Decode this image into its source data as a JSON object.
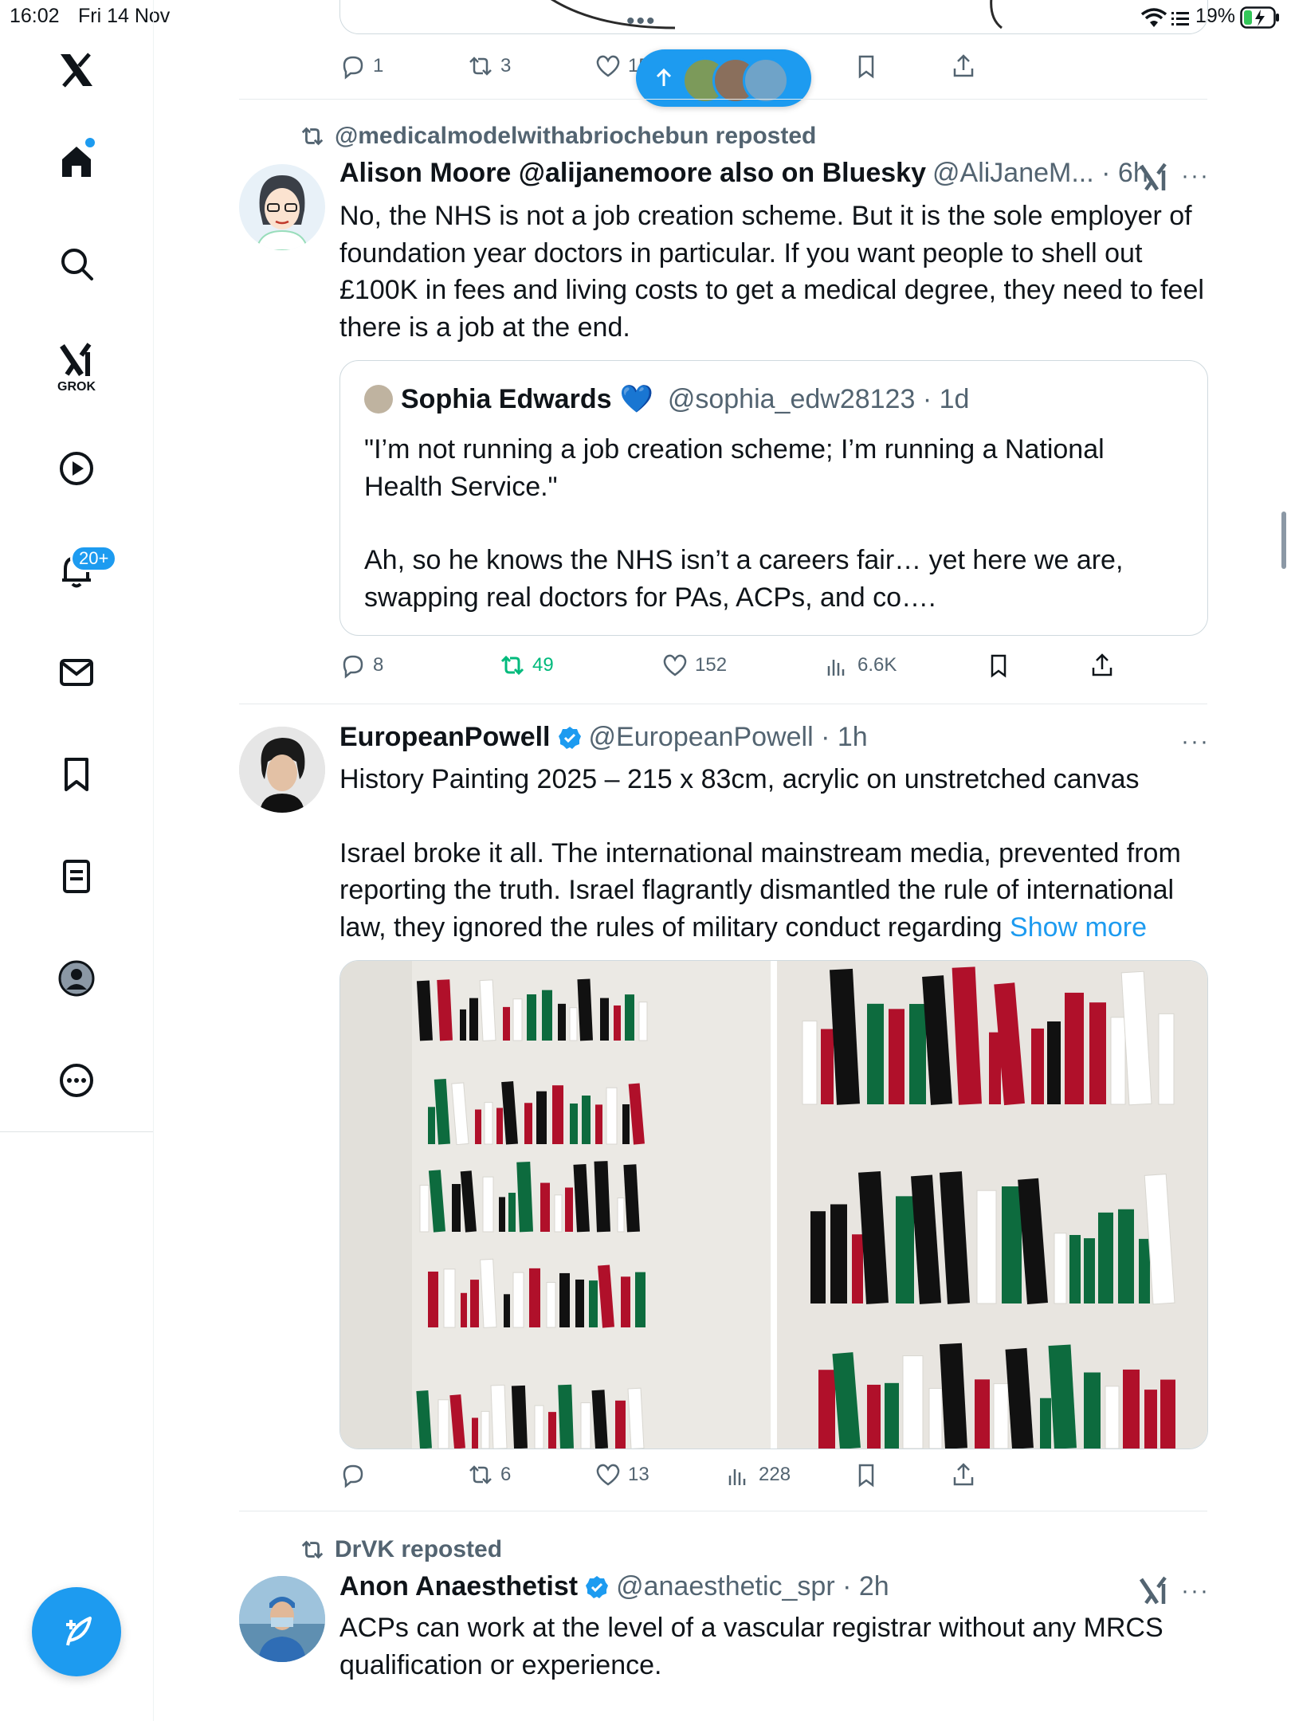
{
  "status_bar": {
    "time": "16:02",
    "date": "Fri 14 Nov",
    "battery": "19%"
  },
  "sidebar": {
    "items": [
      {
        "name": "home",
        "label": ""
      },
      {
        "name": "explore",
        "label": ""
      },
      {
        "name": "grok",
        "label": "GROK"
      },
      {
        "name": "video",
        "label": ""
      },
      {
        "name": "notifications",
        "label": ""
      },
      {
        "name": "messages",
        "label": ""
      },
      {
        "name": "bookmarks",
        "label": ""
      },
      {
        "name": "lists",
        "label": ""
      },
      {
        "name": "profile",
        "label": ""
      },
      {
        "name": "more",
        "label": ""
      }
    ],
    "notifications_badge": "20+"
  },
  "top_tweet_actions": {
    "reply": "1",
    "repost": "3",
    "like": "15"
  },
  "tweets": [
    {
      "repost_by": "@medicalmodelwithabriochebun reposted",
      "name": "Alison Moore @alijanemoore also on Bluesky",
      "handle_time": "@AliJaneM... · 6h",
      "text": "No, the NHS is not a job creation scheme. But it is the sole employer of foundation year doctors in particular. If you want people to shell out £100K in fees and living costs to get a medical degree, they need to feel there is a job at the end.",
      "quote": {
        "name": "Sophia Edwards",
        "heart": "💙",
        "handle_time": "@sophia_edw28123 · 1d",
        "line1": "\"I’m not running a job creation scheme; I’m running a National Health Service.\"",
        "line2": "Ah, so he knows the NHS isn’t a careers fair… yet here we are, swapping real doctors for PAs, ACPs, and co…."
      },
      "actions": {
        "reply": "8",
        "repost": "49",
        "like": "152",
        "views": "6.6K"
      }
    },
    {
      "name": "EuropeanPowell",
      "handle_time": "@EuropeanPowell · 1h",
      "text1": "History Painting 2025 – 215 x 83cm, acrylic on unstretched canvas",
      "text2": "Israel broke it all. The international mainstream media, prevented from reporting the truth. Israel flagrantly dismantled the rule of international law, they ignored the rules of military conduct regarding",
      "show_more": "Show more",
      "actions": {
        "reply": "",
        "repost": "6",
        "like": "13",
        "views": "228"
      }
    },
    {
      "repost_by": "DrVK reposted",
      "name": "Anon Anaesthetist",
      "handle_time": "@anaesthetic_spr · 2h",
      "text": "ACPs can work at the level of a vascular registrar without any MRCS qualification or experience."
    }
  ],
  "colors": {
    "accent": "#1d9bf0",
    "repost_green": "#00ba7c",
    "muted": "#536471"
  }
}
